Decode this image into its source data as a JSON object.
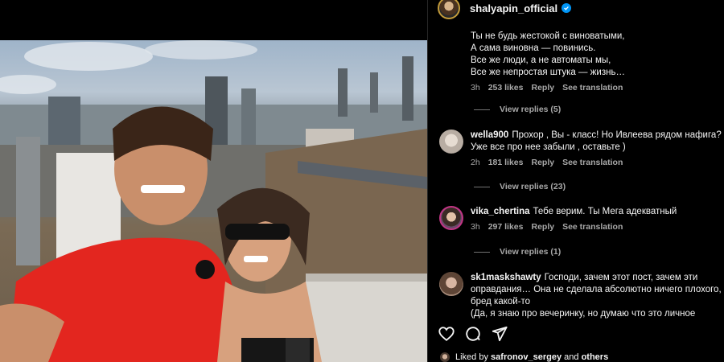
{
  "post": {
    "owner_username": "shalyapin_official",
    "verified": true
  },
  "comments": [
    {
      "username": "",
      "text": "Ты не будь жестокой с виноватыми,\nА сама виновна — повинись.\nВсе же люди, а не автоматы мы,\nВсе же непростая штука — жизнь…",
      "time": "3h",
      "likes": "253 likes",
      "reply_label": "Reply",
      "translate_label": "See translation",
      "view_replies": "View replies (5)"
    },
    {
      "username": "wella900",
      "text": "Прохор , Вы - класс! Но Ивлеева рядом нафига? Уже все про нее забыли , оставьте )",
      "time": "2h",
      "likes": "181 likes",
      "reply_label": "Reply",
      "translate_label": "See translation",
      "view_replies": "View replies (23)"
    },
    {
      "username": "vika_chertina",
      "text": "Тебе верим. Ты Мега адекватный",
      "time": "3h",
      "likes": "297 likes",
      "reply_label": "Reply",
      "translate_label": "See translation",
      "view_replies": "View replies (1)"
    },
    {
      "username": "sk1maskshawty",
      "text": "Господи, зачем этот пост, зачем эти оправдания… Она не сделала абсолютно ничего плохого, бред какой-то\n(Да, я знаю про вечеринку, но думаю что это личное"
    }
  ],
  "actions": {
    "like_icon": "heart-icon",
    "comment_icon": "comment-icon",
    "share_icon": "share-icon"
  },
  "liked_by": {
    "prefix": "Liked by",
    "user": "safronov_sergey",
    "conjunction": "and",
    "others": "others"
  },
  "colors": {
    "background": "#000000",
    "text": "#f5f5f5",
    "muted": "#a8a8a8",
    "verified": "#0095f6"
  }
}
